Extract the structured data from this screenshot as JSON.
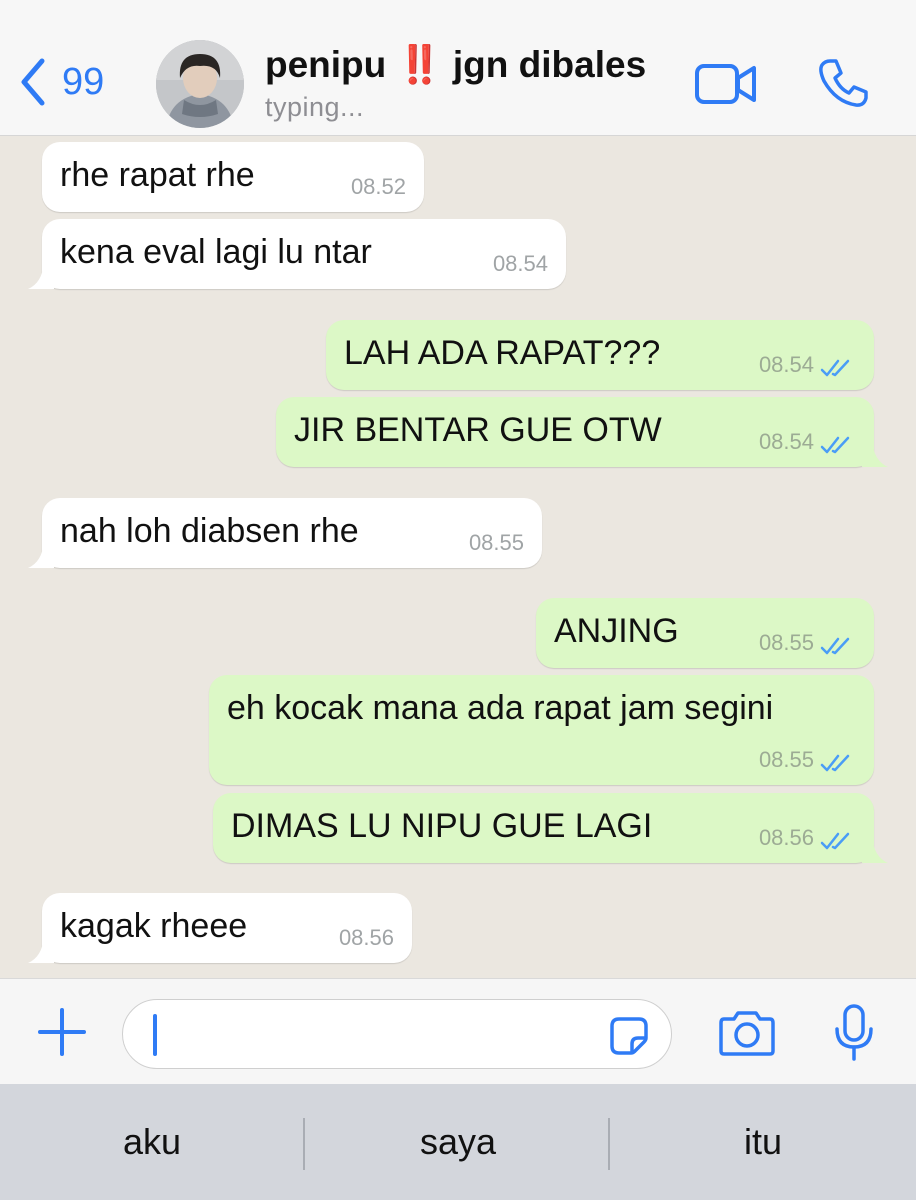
{
  "header": {
    "back_count": "99",
    "contact_name": "penipu",
    "contact_emoji": "‼️",
    "contact_name_suffix": "jgn dibales",
    "status": "typing..."
  },
  "messages": [
    {
      "direction": "in",
      "text": "rhe rapat rhe",
      "time": "08.52"
    },
    {
      "direction": "in",
      "text": "kena eval lagi lu ntar",
      "time": "08.54"
    },
    {
      "direction": "out",
      "text": "LAH ADA RAPAT???",
      "time": "08.54",
      "read": true
    },
    {
      "direction": "out",
      "text": "JIR BENTAR GUE OTW",
      "time": "08.54",
      "read": true
    },
    {
      "direction": "in",
      "text": "nah loh diabsen rhe",
      "time": "08.55"
    },
    {
      "direction": "out",
      "text": "ANJING",
      "time": "08.55",
      "read": true
    },
    {
      "direction": "out",
      "text": "eh kocak mana ada rapat jam segini",
      "time": "08.55",
      "read": true
    },
    {
      "direction": "out",
      "text": "DIMAS LU NIPU GUE LAGI",
      "time": "08.56",
      "read": true
    },
    {
      "direction": "in",
      "text": "kagak rheee",
      "time": "08.56"
    }
  ],
  "composer": {
    "value": ""
  },
  "keyboard": {
    "suggestions": [
      "aku",
      "saya",
      "itu"
    ]
  },
  "colors": {
    "accent": "#2f7bf5",
    "outgoing_bubble": "#dcf8c6",
    "incoming_bubble": "#ffffff",
    "chat_background": "#ebe7e0",
    "emoji_red": "#e0243a"
  },
  "icons": [
    "chevron-left-icon",
    "video-call-icon",
    "phone-icon",
    "plus-icon",
    "sticker-icon",
    "camera-icon",
    "microphone-icon",
    "double-check-icon"
  ]
}
